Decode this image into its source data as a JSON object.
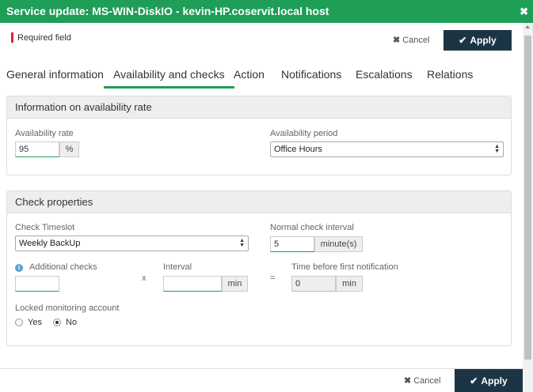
{
  "window": {
    "title": "Service update: MS-WIN-DiskIO - kevin-HP.coservit.local host",
    "close_icon": "close-icon"
  },
  "header": {
    "required_field": "Required field",
    "cancel_label": "Cancel",
    "apply_label": "Apply"
  },
  "tabs": [
    {
      "label": "General information",
      "active": false
    },
    {
      "label": "Availability and checks",
      "active": true
    },
    {
      "label": "Action",
      "active": false
    },
    {
      "label": "Notifications",
      "active": false
    },
    {
      "label": "Escalations",
      "active": false
    },
    {
      "label": "Relations",
      "active": false
    }
  ],
  "availability": {
    "title": "Information on availability rate",
    "rate_label": "Availability rate",
    "rate_value": "95",
    "rate_unit": "%",
    "period_label": "Availability period",
    "period_value": "Office Hours"
  },
  "checks": {
    "title": "Check properties",
    "timeslot_label": "Check Timeslot",
    "timeslot_value": "Weekly BackUp",
    "normal_interval_label": "Normal check interval",
    "normal_interval_value": "5",
    "normal_interval_unit": "minute(s)",
    "additional_label": "Additional checks",
    "additional_value": "",
    "times_symbol": "x",
    "interval_label": "Interval",
    "interval_value": "",
    "interval_unit": "min",
    "equals_symbol": "=",
    "first_notif_label": "Time before first notification",
    "first_notif_value": "0",
    "first_notif_unit": "min",
    "locked_label": "Locked monitoring account",
    "locked_yes": "Yes",
    "locked_no": "No",
    "locked_selected": "No"
  },
  "footer": {
    "cancel_label": "Cancel",
    "apply_label": "Apply"
  },
  "colors": {
    "title_bar": "#1e9e57",
    "apply_button": "#1c3545",
    "required_marker": "#d9232d",
    "active_tab_underline": "#1e9e57"
  }
}
